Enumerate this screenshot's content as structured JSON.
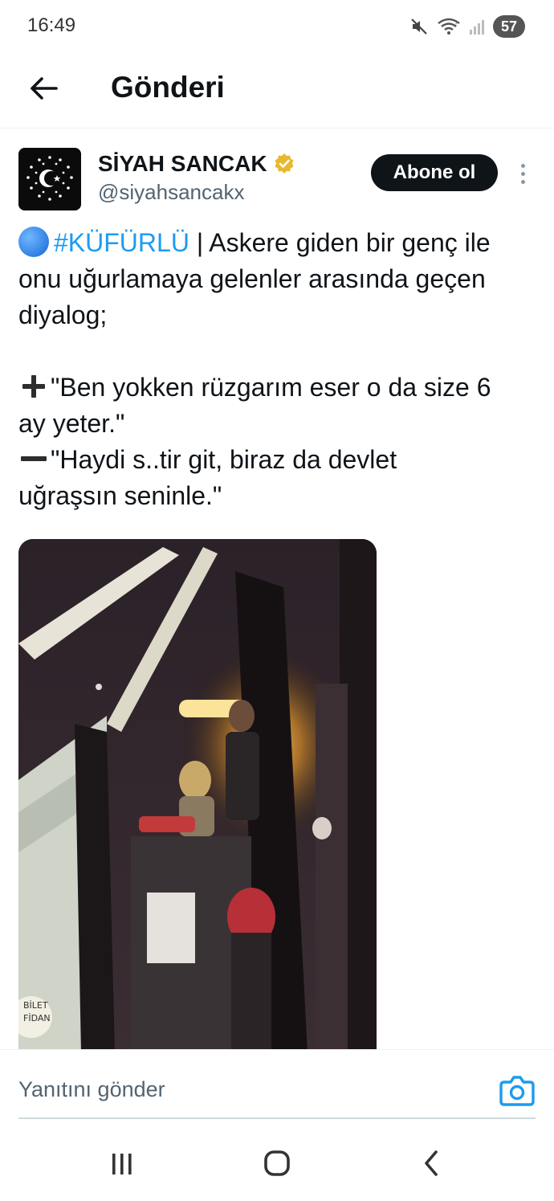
{
  "status_bar": {
    "time": "16:49",
    "battery": "57",
    "icons": [
      "mute-icon",
      "wifi-icon",
      "signal-icon",
      "battery-icon"
    ]
  },
  "header": {
    "title": "Gönderi",
    "back_icon": "arrow-left-icon"
  },
  "post": {
    "author_name": "SİYAH SANCAK",
    "author_handle": "@siyahsancakx",
    "verified_color": "#e8b830",
    "subscribe_label": "Abone ol",
    "text": {
      "hashtag": "#KÜFÜRLÜ",
      "line1_rest": " | Askere giden bir genç ile",
      "line2": "onu uğurlamaya gelenler arasında geçen",
      "line3": "diyalog;",
      "line4": "\"Ben yokken rüzgarım eser o da size 6",
      "line5": "ay yeter.\"",
      "line6": "\"Haydi s..tir git, biraz da devlet",
      "line7": "uğraşsın seninle.\""
    },
    "media_sign_text": "BİLET FİDAN"
  },
  "reply": {
    "placeholder": "Yanıtını gönder",
    "camera_icon": "camera-icon"
  },
  "nav": {
    "recents_icon": "recents-icon",
    "home_icon": "home-icon",
    "back_icon": "back-icon"
  },
  "colors": {
    "accent": "#1d9bf0",
    "text": "#0f1419",
    "secondary": "#536471"
  }
}
